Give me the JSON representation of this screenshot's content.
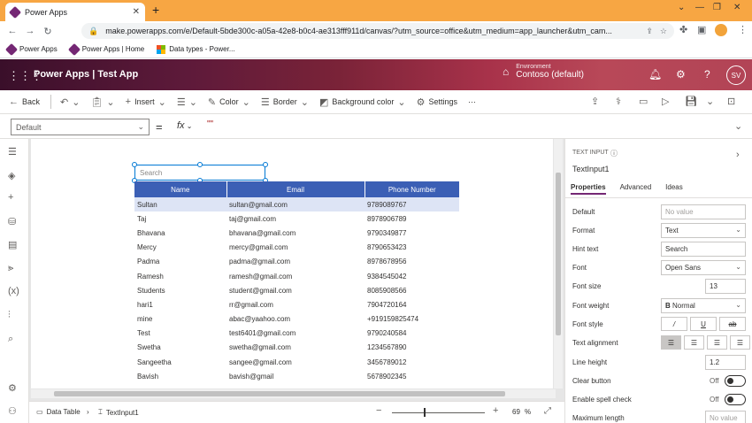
{
  "browser": {
    "tab_title": "Power Apps",
    "url": "make.powerapps.com/e/Default-5bde300c-a05a-42e8-b0c4-ae313fff911d/canvas/?utm_source=office&utm_medium=app_launcher&utm_cam...",
    "bookmarks": [
      {
        "label": "Power Apps"
      },
      {
        "label": "Power Apps | Home"
      },
      {
        "label": "Data types - Power..."
      }
    ]
  },
  "header": {
    "app_title": "Power Apps  |  Test App",
    "environment_label": "Environment",
    "environment_name": "Contoso (default)",
    "user_initials": "SV"
  },
  "commandbar": {
    "back": "Back",
    "insert": "Insert",
    "color": "Color",
    "border": "Border",
    "background_color": "Background color",
    "settings": "Settings",
    "more": "···"
  },
  "formulabar": {
    "property": "Default",
    "equals": "=",
    "fx": "fx",
    "formula": "\"\""
  },
  "canvas": {
    "search_placeholder": "Search",
    "table": {
      "headers": [
        "Name",
        "Email",
        "Phone Number"
      ],
      "rows": [
        [
          "Sultan",
          "sultan@gmail.com",
          "9789089767"
        ],
        [
          "Taj",
          "taj@gmail.com",
          "8978906789"
        ],
        [
          "Bhavana",
          "bhavana@gmail.com",
          "9790349877"
        ],
        [
          "Mercy",
          "mercy@gmail.com",
          "8790653423"
        ],
        [
          "Padma",
          "padma@gmail.com",
          "8978678956"
        ],
        [
          "Ramesh",
          "ramesh@gmail.com",
          "9384545042"
        ],
        [
          "Students",
          "student@gmail.com",
          "8085908566"
        ],
        [
          "hari1",
          "rr@gmail.com",
          "7904720164"
        ],
        [
          "mine",
          "abac@yaahoo.com",
          "+919159825474"
        ],
        [
          "Test",
          "test6401@gmail.com",
          "9790240584"
        ],
        [
          "Swetha",
          "swetha@gmail.com",
          "1234567890"
        ],
        [
          "Sangeetha",
          "sangee@gmail.com",
          "3456789012"
        ],
        [
          "Bavish",
          "bavish@gmail",
          "5678902345"
        ]
      ]
    }
  },
  "bottombar": {
    "crumb1": "Data Table",
    "crumb2": "TextInput1",
    "zoom_minus": "−",
    "zoom_plus": "+",
    "zoom_value": "69",
    "zoom_unit": "%"
  },
  "panel": {
    "type": "TEXT INPUT",
    "name": "TextInput1",
    "tabs": [
      "Properties",
      "Advanced",
      "Ideas"
    ],
    "props": {
      "default_label": "Default",
      "default_placeholder": "No value",
      "format_label": "Format",
      "format_value": "Text",
      "hint_label": "Hint text",
      "hint_value": "Search",
      "font_label": "Font",
      "font_value": "Open Sans",
      "fontsize_label": "Font size",
      "fontsize_value": "13",
      "fontweight_label": "Font weight",
      "fontweight_icon": "B",
      "fontweight_value": "Normal",
      "fontstyle_label": "Font style",
      "textalign_label": "Text alignment",
      "lineheight_label": "Line height",
      "lineheight_value": "1.2",
      "clearbutton_label": "Clear button",
      "clearbutton_value": "Off",
      "spellcheck_label": "Enable spell check",
      "spellcheck_value": "Off",
      "maxlength_label": "Maximum length",
      "maxlength_placeholder": "No value"
    }
  },
  "colors": {
    "accent": "#742774",
    "table_header": "#3b5fb5",
    "selected_row": "#dde4f5",
    "browser_tabbar": "#f7a643"
  }
}
